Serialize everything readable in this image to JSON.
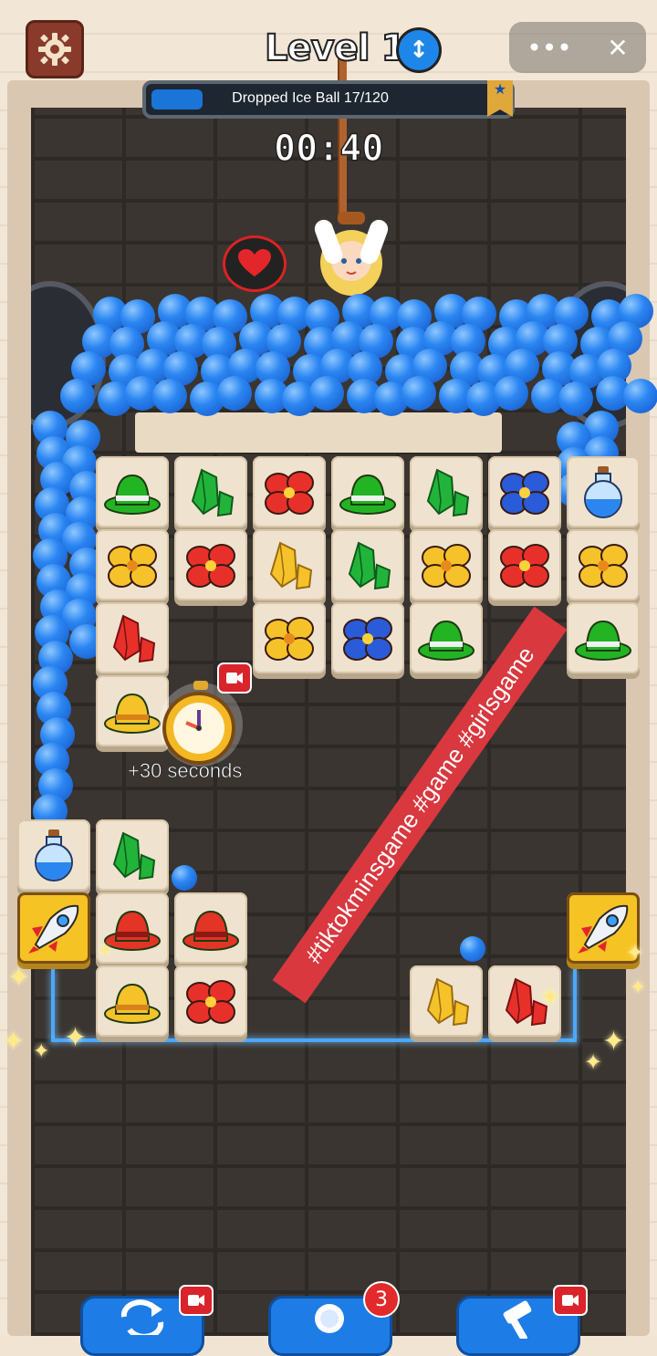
{
  "header": {
    "level_label": "Level 11",
    "settings_icon": "gear-icon",
    "level_icon": "vertical-arrows-icon",
    "system_menu": "•••",
    "system_close": "✕"
  },
  "progress": {
    "label": "Dropped Ice Ball",
    "count_text": "17/120",
    "value": 17,
    "max": 120
  },
  "timer": {
    "text": "00:40"
  },
  "stopwatch": {
    "label": "+30 seconds",
    "icon": "stopwatch-icon"
  },
  "overlay": {
    "hashtags": "#tiktokminsgame #game #girlsgame"
  },
  "bottom_bar": {
    "shuffle_icon": "shuffle-icon",
    "hint_icon": "magnifier-icon",
    "hint_count": "3",
    "hammer_icon": "hammer-icon"
  },
  "colors": {
    "ball_blue": "#2b86f2",
    "tile_bg": "#efe3cf",
    "booster_gold": "#f6c325",
    "hashtag_red": "#d8383e"
  },
  "tiles": [
    {
      "row": 0,
      "col": 0,
      "item": "green-hat"
    },
    {
      "row": 0,
      "col": 1,
      "item": "green-crystal"
    },
    {
      "row": 0,
      "col": 2,
      "item": "red-flower"
    },
    {
      "row": 0,
      "col": 3,
      "item": "green-hat"
    },
    {
      "row": 0,
      "col": 4,
      "item": "green-crystal"
    },
    {
      "row": 0,
      "col": 5,
      "item": "blue-flower"
    },
    {
      "row": 0,
      "col": 6,
      "item": "blue-potion"
    },
    {
      "row": 1,
      "col": 0,
      "item": "yellow-flower"
    },
    {
      "row": 1,
      "col": 1,
      "item": "red-flower"
    },
    {
      "row": 1,
      "col": 2,
      "item": "yellow-crystal"
    },
    {
      "row": 1,
      "col": 3,
      "item": "green-crystal"
    },
    {
      "row": 1,
      "col": 4,
      "item": "yellow-flower"
    },
    {
      "row": 1,
      "col": 5,
      "item": "red-flower"
    },
    {
      "row": 1,
      "col": 6,
      "item": "yellow-flower"
    },
    {
      "row": 2,
      "col": 0,
      "item": "red-crystal"
    },
    {
      "row": 2,
      "col": 2,
      "item": "yellow-flower"
    },
    {
      "row": 2,
      "col": 3,
      "item": "blue-flower"
    },
    {
      "row": 2,
      "col": 4,
      "item": "green-hat"
    },
    {
      "row": 2,
      "col": 6,
      "item": "green-hat"
    },
    {
      "row": 3,
      "col": 0,
      "item": "yellow-hat"
    },
    {
      "row": 5,
      "col": -1,
      "item": "blue-potion"
    },
    {
      "row": 5,
      "col": 0,
      "item": "green-crystal"
    },
    {
      "row": 6,
      "col": -1,
      "item": "rocket"
    },
    {
      "row": 6,
      "col": 0,
      "item": "red-hat"
    },
    {
      "row": 6,
      "col": 1,
      "item": "red-hat"
    },
    {
      "row": 6,
      "col": 6,
      "item": "rocket"
    },
    {
      "row": 7,
      "col": 0,
      "item": "yellow-hat"
    },
    {
      "row": 7,
      "col": 1,
      "item": "red-flower"
    },
    {
      "row": 7,
      "col": 4,
      "item": "yellow-crystal"
    },
    {
      "row": 7,
      "col": 5,
      "item": "red-crystal"
    }
  ]
}
